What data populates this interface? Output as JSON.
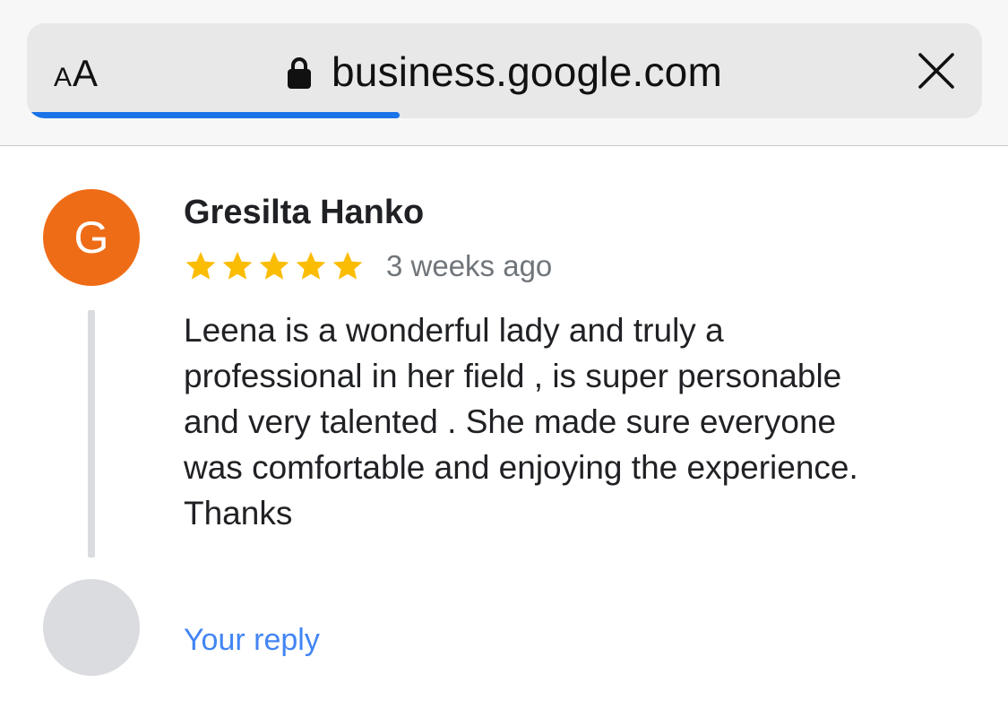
{
  "browser": {
    "text_size_small": "A",
    "text_size_large": "A",
    "url": "business.google.com",
    "load_progress": 0.39,
    "accent_color": "#1a73e8"
  },
  "review": {
    "avatar_initial": "G",
    "avatar_color": "#ef6c17",
    "reviewer_name": "Gresilta Hanko",
    "rating": 5,
    "rating_max": 5,
    "star_color": "#fbbc04",
    "time": "3 weeks ago",
    "lines": [
      "Leena is a wonderful lady and truly a",
      "professional in her field , is super personable",
      "and very talented . She made sure everyone",
      "was comfortable and enjoying the experience.",
      "Thanks"
    ]
  },
  "reply": {
    "label": "Your reply",
    "link_color": "#4285f4"
  }
}
